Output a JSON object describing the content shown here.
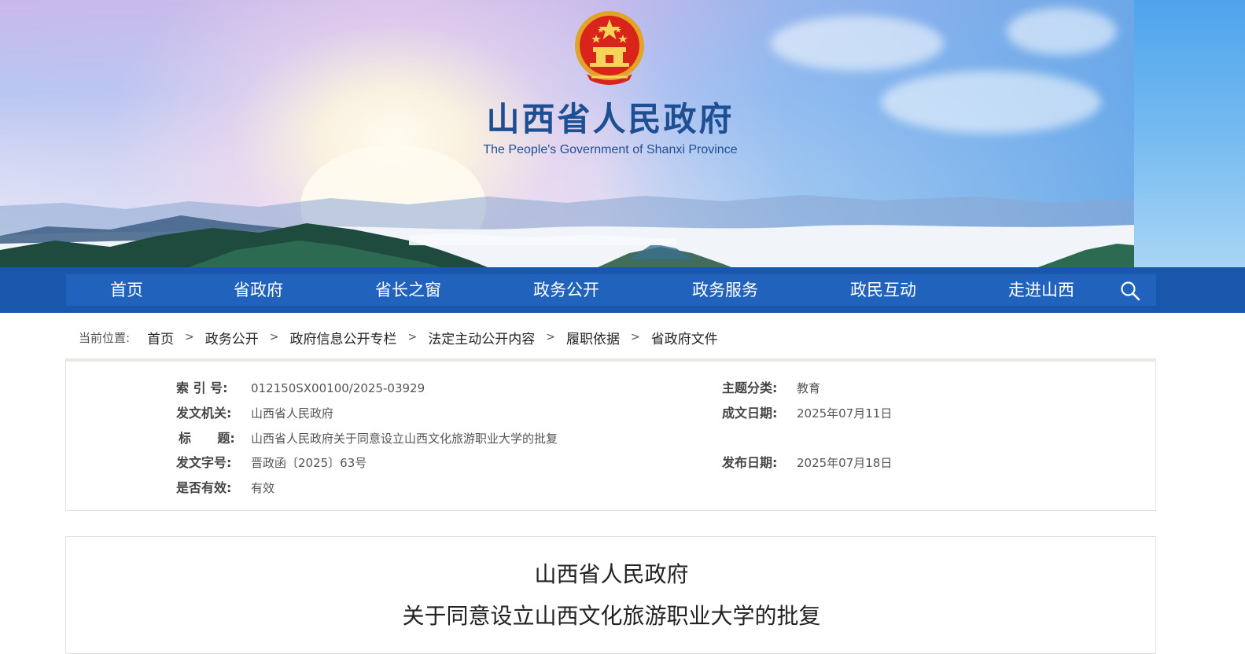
{
  "site": {
    "name_cn": "山西省人民政府",
    "name_en": "The People's Government of Shanxi Province"
  },
  "icons": {
    "emblem": "national-emblem-icon",
    "search": "search-icon"
  },
  "colors": {
    "nav_band": "#1957ad",
    "nav_bar": "#2163bc",
    "title_blue": "#1f4f93"
  },
  "nav": {
    "items": [
      "首页",
      "省政府",
      "省长之窗",
      "政务公开",
      "政务服务",
      "政民互动",
      "走进山西"
    ]
  },
  "breadcrumb": {
    "label": "当前位置:",
    "items": [
      "首页",
      "政务公开",
      "政府信息公开专栏",
      "法定主动公开内容",
      "履职依据",
      "省政府文件"
    ],
    "separator": ">"
  },
  "meta": {
    "index_no": {
      "key": "索  引 号:",
      "value": "012150SX00100/2025-03929"
    },
    "issuer": {
      "key": "发文机关:",
      "value": "山西省人民政府"
    },
    "title": {
      "key": "标      题:",
      "value": "山西省人民政府关于同意设立山西文化旅游职业大学的批复"
    },
    "doc_no": {
      "key": "发文字号:",
      "value": "晋政函〔2025〕63号"
    },
    "valid": {
      "key": "是否有效:",
      "value": "有效"
    },
    "category": {
      "key": "主题分类:",
      "value": "教育"
    },
    "created": {
      "key": "成文日期:",
      "value": "2025年07月11日"
    },
    "published": {
      "key": "发布日期:",
      "value": "2025年07月18日"
    }
  },
  "document": {
    "title_line1": "山西省人民政府",
    "title_line2": "关于同意设立山西文化旅游职业大学的批复"
  }
}
